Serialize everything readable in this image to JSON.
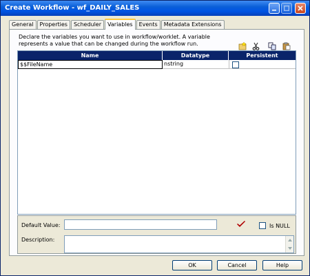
{
  "window": {
    "title": "Create Workflow - wf_DAILY_SALES"
  },
  "tabs": [
    {
      "label": "General"
    },
    {
      "label": "Properties"
    },
    {
      "label": "Scheduler"
    },
    {
      "label": "Variables"
    },
    {
      "label": "Events"
    },
    {
      "label": "Metadata Extensions"
    }
  ],
  "active_tab": "Variables",
  "variables": {
    "description_line1": "Declare the variables you want to use in workflow/worklet.  A variable",
    "description_line2": "represents a value that can be changed during the workflow run.",
    "columns": {
      "name": "Name",
      "datatype": "Datatype",
      "persistent": "Persistent"
    },
    "rows": [
      {
        "name": "$$FileName",
        "datatype": "nstring",
        "persistent": false
      }
    ],
    "toolbar_icons": [
      "new-variable-icon",
      "cut-icon",
      "copy-icon",
      "paste-icon"
    ]
  },
  "fields": {
    "default_value_label": "Default Value:",
    "default_value": "",
    "is_null_label": "Is NULL",
    "is_null": false,
    "description_label": "Description:",
    "description": ""
  },
  "buttons": {
    "ok": "OK",
    "cancel": "Cancel",
    "help": "Help"
  },
  "colors": {
    "title_bar": "#0054e3",
    "grid_header": "#0a246a",
    "checkmark": "#c00000",
    "tab_highlight": "#ffc83c"
  }
}
